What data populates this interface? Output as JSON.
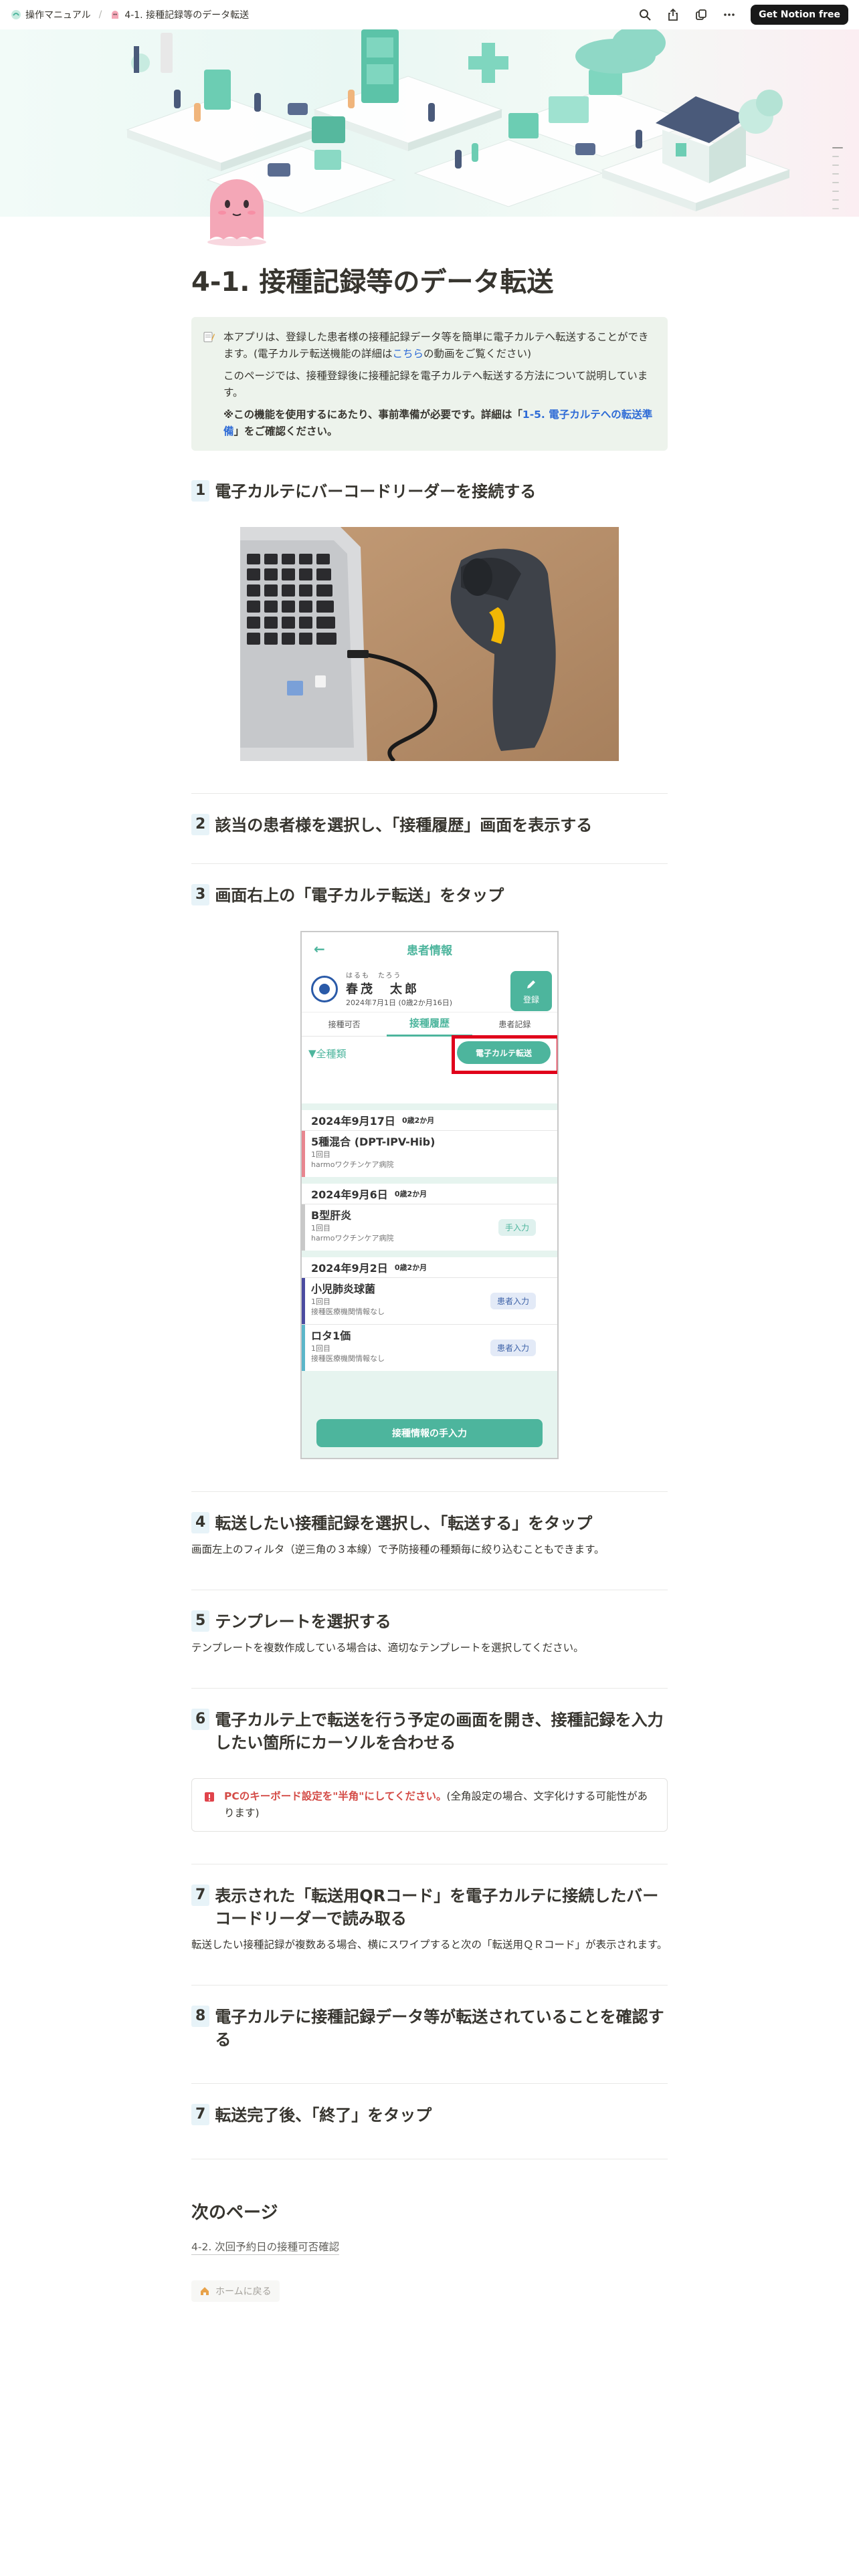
{
  "breadcrumb": {
    "parent": "操作マニュアル",
    "current": "4-1. 接種記録等のデータ転送"
  },
  "topbar": {
    "notion_button": "Get Notion free"
  },
  "icons": {
    "search": "search-icon",
    "share": "share-icon",
    "duplicate": "duplicate-icon",
    "more": "more-icon"
  },
  "page": {
    "title": "4-1. 接種記録等のデータ転送"
  },
  "callout": {
    "line1_pre": "本アプリは、登録した患者様の接種記録データ等を簡単に電子カルテへ転送することができます。(電子カルテ転送機能の詳細は",
    "line1_link": "こちら",
    "line1_post": "の動画をご覧ください)",
    "line2": "このページでは、接種登録後に接種記録を電子カルテへ転送する方法について説明しています。",
    "line3_pre": "※この機能を使用するにあたり、事前準備が必要です。詳細は「",
    "line3_link": "1-5. 電子カルテへの転送準備",
    "line3_post": "」をご確認ください。"
  },
  "steps": [
    {
      "num": "1",
      "title": "電子カルテにバーコードリーダーを接続する",
      "desc": ""
    },
    {
      "num": "2",
      "title": "該当の患者様を選択し、「接種履歴」画面を表示する",
      "desc": ""
    },
    {
      "num": "3",
      "title": "画面右上の「電子カルテ転送」をタップ",
      "desc": ""
    },
    {
      "num": "4",
      "title": "転送したい接種記録を選択し、「転送する」をタップ",
      "desc": "画面左上のフィルタ（逆三角の３本線）で予防接種の種類毎に絞り込むこともできます。"
    },
    {
      "num": "5",
      "title": "テンプレートを選択する",
      "desc": "テンプレートを複数作成している場合は、適切なテンプレートを選択してください。"
    },
    {
      "num": "6",
      "title": "電子カルテ上で転送を行う予定の画面を開き、接種記録を入力したい箇所にカーソルを合わせる",
      "desc": ""
    },
    {
      "num": "7",
      "title": "表示された「転送用QRコード」を電子カルテに接続したバーコードリーダーで読み取る",
      "desc": "転送したい接種記録が複数ある場合、横にスワイプすると次の「転送用ＱＲコード」が表示されます。"
    },
    {
      "num": "8",
      "title": "電子カルテに接種記録データ等が転送されていることを確認する",
      "desc": ""
    },
    {
      "num": "7",
      "title": "転送完了後、「終了」をタップ",
      "desc": ""
    }
  ],
  "warning": {
    "red": "PCのキーボード設定を\"半角\"にしてください。",
    "rest": "(全角設定の場合、文字化けする可能性があります)"
  },
  "phone": {
    "header": "患者情報",
    "ruby": "はるも　たろう",
    "name": "春茂　太郎",
    "dob": "2024年7月1日 (0歳2か月16日)",
    "register": "登録",
    "tabs": [
      "接種可否",
      "接種履歴",
      "患者記録"
    ],
    "filter": "全種類",
    "transfer_button": "電子カルテ転送",
    "groups": [
      {
        "date": "2024年9月17日",
        "age": "0歳2か月",
        "items": [
          {
            "name": "5種混合 (DPT-IPV-Hib)",
            "dose": "1回目",
            "clinic": "harmoワクチンケア病院",
            "badge": "",
            "color": "#e8868f"
          }
        ]
      },
      {
        "date": "2024年9月6日",
        "age": "0歳2か月",
        "items": [
          {
            "name": "B型肝炎",
            "dose": "1回目",
            "clinic": "harmoワクチンケア病院",
            "badge": "手入力",
            "color": "#c8c8c8"
          }
        ]
      },
      {
        "date": "2024年9月2日",
        "age": "0歳2か月",
        "items": [
          {
            "name": "小児肺炎球菌",
            "dose": "1回目",
            "clinic": "接種医療機関情報なし",
            "badge": "患者入力",
            "color": "#4b4ca0"
          },
          {
            "name": "ロタ1価",
            "dose": "1回目",
            "clinic": "接種医療機関情報なし",
            "badge": "患者入力",
            "color": "#5bb6c9"
          }
        ]
      }
    ],
    "manual_button": "接種情報の手入力"
  },
  "next": {
    "heading": "次のページ",
    "link": "4-2. 次回予約日の接種可否確認",
    "home": "ホームに戻る"
  }
}
